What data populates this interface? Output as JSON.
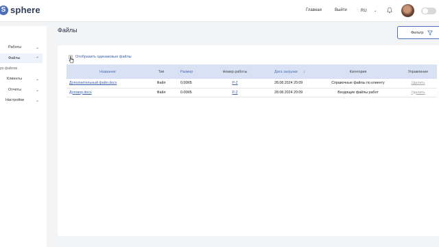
{
  "app": {
    "logo_letter": "S",
    "name": "sphere"
  },
  "header": {
    "nav_home": "Главная",
    "nav_logout": "Выйти",
    "lang": "RU"
  },
  "sidebar": {
    "items": [
      {
        "label": "Работы"
      },
      {
        "label": "Файлы"
      },
      {
        "label": "Клиенты"
      },
      {
        "label": "Отчеты"
      },
      {
        "label": "Настройки"
      }
    ],
    "sub_label": "ро файлов"
  },
  "page": {
    "title": "Файлы",
    "filter_label": "Фильтр"
  },
  "files": {
    "show_duplicates_label": "Отобразить одинаковые файлы",
    "columns": {
      "name": "Название",
      "type": "Тип",
      "size": "Размер",
      "job_number": "Номер работы",
      "upload_date": "Дата загрузки",
      "category": "Категория",
      "actions": "Управление"
    },
    "rows": [
      {
        "name": "Дополнительный файл.docx",
        "type": "Файл",
        "size": "0.00КБ",
        "job_number": "P-2",
        "upload_date": "28.08.2024 20:09",
        "category": "Справочные файлы по клиенту",
        "action": "Удалить"
      },
      {
        "name": "Договор.docx",
        "type": "Файл",
        "size": "0.00КБ",
        "job_number": "P-2",
        "upload_date": "28.08.2024 20:09",
        "category": "Входящие файлы работ",
        "action": "Удалить"
      }
    ]
  },
  "colors": {
    "accent": "#4d6fb8",
    "table_header_bg": "#d8e2f4",
    "link": "#3a5fa8"
  }
}
